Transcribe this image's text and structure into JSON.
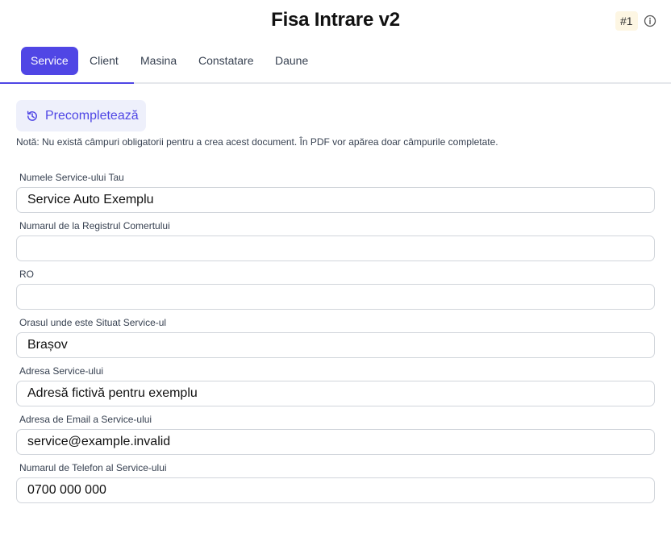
{
  "header": {
    "title": "Fisa Intrare v2",
    "doc_number": "#1"
  },
  "tabs": [
    {
      "label": "Service",
      "active": true
    },
    {
      "label": "Client",
      "active": false
    },
    {
      "label": "Masina",
      "active": false
    },
    {
      "label": "Constatare",
      "active": false
    },
    {
      "label": "Daune",
      "active": false
    }
  ],
  "prefill": {
    "label": "Precompletează",
    "icon": "history-icon"
  },
  "note": "Notă: Nu există câmpuri obligatorii pentru a crea acest document. În PDF vor apărea doar câmpurile completate.",
  "fields": [
    {
      "label": "Numele Service-ului Tau",
      "value": ""
    },
    {
      "label": "Numarul de la Registrul Comertului",
      "value": ""
    },
    {
      "label": "RO",
      "value": ""
    },
    {
      "label": "Orasul unde este Situat Service-ul",
      "value": "Brașov"
    },
    {
      "label": "Adresa Service-ului",
      "value": "Adresă fictivă pentru exemplu"
    },
    {
      "label": "Adresa de Email a Service-ului",
      "value": "service@example.invalid"
    },
    {
      "label": "Numarul de Telefon al Service-ului",
      "value": "0700 000 000"
    }
  ],
  "colors": {
    "accent": "#5046e5",
    "prefill_bg": "#eef0fb",
    "badge_bg": "#fdf6e3"
  }
}
